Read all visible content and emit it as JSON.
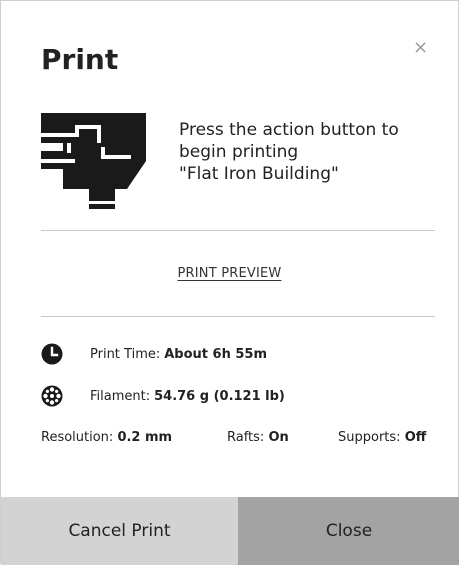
{
  "dialog": {
    "title": "Print",
    "close_symbol": "×"
  },
  "message": {
    "line1": "Press the action button to",
    "line2": "begin printing",
    "line3": "\"Flat Iron Building\""
  },
  "preview_link": "PRINT PREVIEW",
  "stats": {
    "print_time_label": "Print Time:",
    "print_time_value": "About 6h 55m",
    "filament_label": "Filament:",
    "filament_value": "54.76 g (0.121 lb)"
  },
  "settings": {
    "resolution_label": "Resolution:",
    "resolution_value": "0.2 mm",
    "rafts_label": "Rafts:",
    "rafts_value": "On",
    "supports_label": "Supports:",
    "supports_value": "Off"
  },
  "buttons": {
    "cancel_label": "Cancel Print",
    "close_label": "Close"
  },
  "icons": {
    "hero": "printer-nozzle-hand-icon",
    "print_time": "clock-icon",
    "filament": "filament-spool-icon",
    "close": "close-icon"
  },
  "colors": {
    "cancel_button_bg": "#d3d3d3",
    "close_button_bg": "#a3a3a3",
    "divider": "#c8c8c8"
  }
}
